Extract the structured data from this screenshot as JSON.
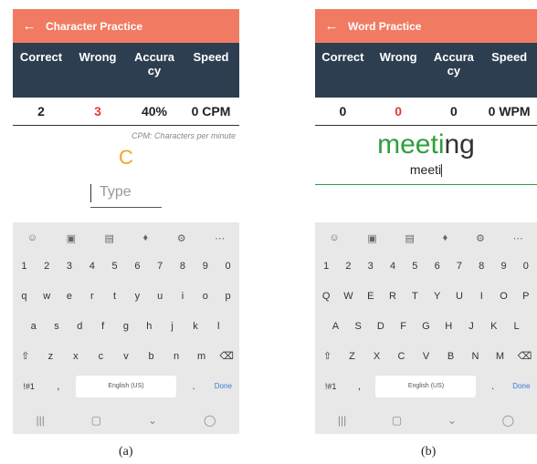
{
  "panel_a": {
    "title": "Character Practice",
    "back_icon": "←",
    "headers": [
      "Correct",
      "Wrong",
      "Accura\ncy",
      "Speed"
    ],
    "values": [
      "2",
      "3",
      "40%",
      "0 CPM"
    ],
    "note": "CPM: Characters per minute",
    "target_char": "C",
    "input_placeholder": "Type",
    "keyboard": {
      "tools": [
        "☺",
        "▣",
        "▤",
        "♦",
        "⚙",
        "⋯"
      ],
      "row1": [
        "1",
        "2",
        "3",
        "4",
        "5",
        "6",
        "7",
        "8",
        "9",
        "0"
      ],
      "row2": [
        "q",
        "w",
        "e",
        "r",
        "t",
        "y",
        "u",
        "i",
        "o",
        "p"
      ],
      "row3": [
        "a",
        "s",
        "d",
        "f",
        "g",
        "h",
        "j",
        "k",
        "l"
      ],
      "row4": [
        "⇧",
        "z",
        "x",
        "c",
        "v",
        "b",
        "n",
        "m",
        "⌫"
      ],
      "row5": [
        "!#1",
        ",",
        "English (US)",
        ".",
        "Done"
      ],
      "nav": [
        "|||",
        "▢",
        "⌄",
        "◯"
      ]
    },
    "caption": "(a)"
  },
  "panel_b": {
    "title": "Word Practice",
    "back_icon": "←",
    "headers": [
      "Correct",
      "Wrong",
      "Accura\ncy",
      "Speed"
    ],
    "values": [
      "0",
      "0",
      "0",
      "0 WPM"
    ],
    "word_done": "meeti",
    "word_rest": "ng",
    "typed": "meeti",
    "keyboard": {
      "tools": [
        "☺",
        "▣",
        "▤",
        "♦",
        "⚙",
        "⋯"
      ],
      "row1": [
        "1",
        "2",
        "3",
        "4",
        "5",
        "6",
        "7",
        "8",
        "9",
        "0"
      ],
      "row2": [
        "Q",
        "W",
        "E",
        "R",
        "T",
        "Y",
        "U",
        "I",
        "O",
        "P"
      ],
      "row3": [
        "A",
        "S",
        "D",
        "F",
        "G",
        "H",
        "J",
        "K",
        "L"
      ],
      "row4": [
        "⇧",
        "Z",
        "X",
        "C",
        "V",
        "B",
        "N",
        "M",
        "⌫"
      ],
      "row5": [
        "!#1",
        ",",
        "English (US)",
        ".",
        "Done"
      ],
      "nav": [
        "|||",
        "▢",
        "⌄",
        "◯"
      ]
    },
    "caption": "(b)"
  },
  "colors": {
    "appbar": "#f07b62",
    "header": "#2c3e50",
    "wrong": "#e53935",
    "target": "#f5a623",
    "correct_letters": "#2e9e3e"
  }
}
